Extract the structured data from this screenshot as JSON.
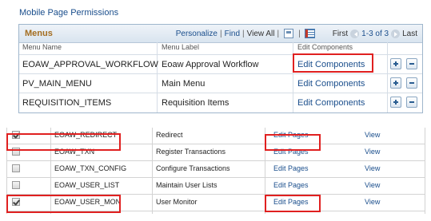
{
  "section_title": "Mobile Page Permissions",
  "menus_grid": {
    "caption": "Menus",
    "toolbar": {
      "personalize": "Personalize",
      "find": "Find",
      "view_all": "View All",
      "first": "First",
      "range": "1-3 of 3",
      "last": "Last"
    },
    "columns": {
      "menu_name": "Menu Name",
      "menu_label": "Menu Label",
      "edit_components": "Edit Components"
    },
    "rows": [
      {
        "name": "EOAW_APPROVAL_WORKFLOW",
        "label": "Eoaw Approval Workflow",
        "action": "Edit Components"
      },
      {
        "name": "PV_MAIN_MENU",
        "label": "Main Menu",
        "action": "Edit Components"
      },
      {
        "name": "REQUISITION_ITEMS",
        "label": "Requisition Items",
        "action": "Edit Components"
      }
    ]
  },
  "pages_grid": {
    "rows": [
      {
        "checked": true,
        "name": "EOAW_REDIRECT",
        "label": "Redirect",
        "edit": "Edit Pages",
        "view": "View"
      },
      {
        "checked": false,
        "name": "EOAW_TXN",
        "label": "Register Transactions",
        "edit": "Edit Pages",
        "view": "View"
      },
      {
        "checked": false,
        "name": "EOAW_TXN_CONFIG",
        "label": "Configure Transactions",
        "edit": "Edit Pages",
        "view": "View"
      },
      {
        "checked": false,
        "name": "EOAW_USER_LIST",
        "label": "Maintain User Lists",
        "edit": "Edit Pages",
        "view": "View"
      },
      {
        "checked": true,
        "name": "EOAW_USER_MON",
        "label": "User Monitor",
        "edit": "Edit Pages",
        "view": "View"
      }
    ]
  },
  "colors": {
    "highlight": "#e02020",
    "link": "#1a4e8c",
    "caption": "#a36d20"
  }
}
